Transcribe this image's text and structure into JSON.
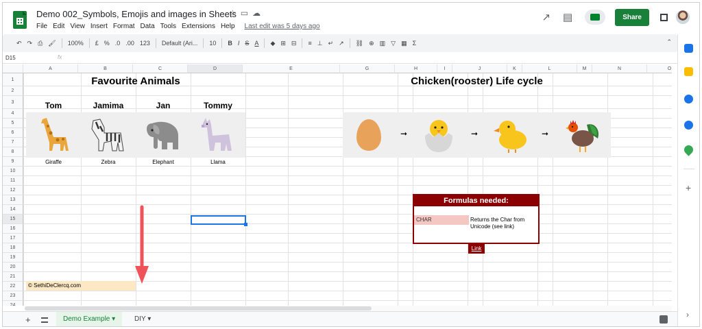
{
  "header": {
    "title": "Demo 002_Symbols, Emojis and images in Sheets",
    "star_icon": "star-icon",
    "menu": [
      "File",
      "Edit",
      "View",
      "Insert",
      "Format",
      "Data",
      "Tools",
      "Extensions",
      "Help"
    ],
    "last_edit": "Last edit was 5 days ago",
    "share_label": "Share"
  },
  "toolbar": {
    "zoom": "100%",
    "currency": "£",
    "percent": "%",
    "dec_less": ".0",
    "dec_more": ".00",
    "format_more": "123",
    "font": "Default (Ari...",
    "font_size": "10",
    "bold": "B",
    "italic": "I",
    "strike": "S",
    "text_color": "A"
  },
  "formula_bar": {
    "name_box": "D15",
    "fx": "fx",
    "value": ""
  },
  "columns": [
    "A",
    "B",
    "C",
    "D",
    "E",
    "G",
    "H",
    "I",
    "J",
    "K",
    "L",
    "M",
    "N",
    "O"
  ],
  "rows": [
    "1",
    "2",
    "3",
    "4",
    "5",
    "6",
    "7",
    "8",
    "9",
    "10",
    "11",
    "12",
    "13",
    "14",
    "15",
    "16",
    "17",
    "18",
    "19",
    "20",
    "21",
    "22",
    "23",
    "24"
  ],
  "sheet": {
    "title_left": "Favourite Animals",
    "title_right": "Chicken(rooster) Life cycle",
    "names": [
      "Tom",
      "Jamima",
      "Jan",
      "Tommy"
    ],
    "animals": [
      "Giraffe",
      "Zebra",
      "Elephant",
      "Llama"
    ],
    "copyright": "© SethiDeClercq.com",
    "formulas_box": {
      "header": "Formulas needed:",
      "code": "CHAR",
      "description": "Returns the Char from Unicode (see link)",
      "link": "Link"
    }
  },
  "tabs": {
    "active": "Demo Example",
    "second": "DIY"
  },
  "colors": {
    "brand_green": "#188038",
    "accent_red": "#8b0000",
    "selection_blue": "#1a73e8",
    "arrow_red": "#f0525a"
  }
}
